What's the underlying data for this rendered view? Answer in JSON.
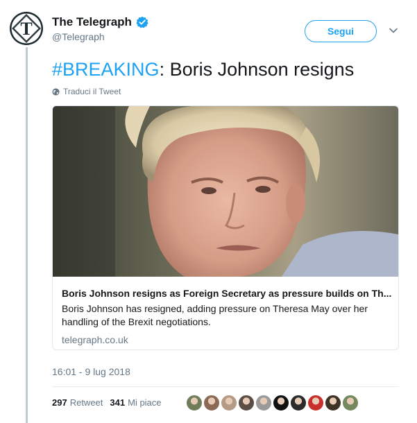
{
  "author": {
    "name": "The Telegraph",
    "handle": "@Telegraph",
    "avatar_letter": "T",
    "verified_icon": "verified-badge-icon"
  },
  "follow_label": "Segui",
  "tweet": {
    "hashtag": "#BREAKING",
    "rest": ": Boris Johnson resigns"
  },
  "translate_label": "Traduci il Tweet",
  "card": {
    "title": "Boris Johnson resigns as Foreign Secretary as pressure builds on Th...",
    "description": "Boris Johnson has resigned, adding pressure on Theresa May over her handling of the Brexit negotiations.",
    "domain": "telegraph.co.uk"
  },
  "timestamp": "16:01 - 9 lug 2018",
  "stats": {
    "retweets_count": "297",
    "retweets_label": "Retweet",
    "likes_count": "341",
    "likes_label": "Mi piace"
  },
  "likers": [
    {
      "color": "#6f7d5a"
    },
    {
      "color": "#8a6a55"
    },
    {
      "color": "#b39b86"
    },
    {
      "color": "#5b4e47"
    },
    {
      "color": "#9a9a9a"
    },
    {
      "color": "#111111"
    },
    {
      "color": "#2b2b2b"
    },
    {
      "color": "#c8302c"
    },
    {
      "color": "#3d3226"
    },
    {
      "color": "#748a5e"
    }
  ],
  "colors": {
    "accent": "#1da1f2",
    "secondary_text": "#657786",
    "thread_line": "#aab8c2"
  }
}
